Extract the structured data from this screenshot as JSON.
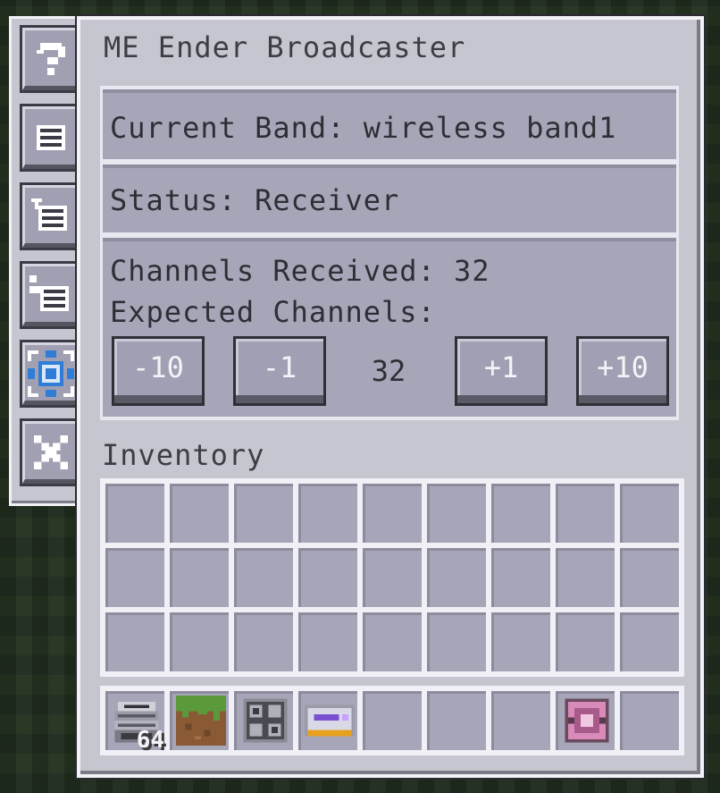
{
  "window": {
    "title": "ME Ender Broadcaster"
  },
  "sidebar": {
    "tabs": [
      {
        "name": "help-icon"
      },
      {
        "name": "list-icon"
      },
      {
        "name": "list-add-icon"
      },
      {
        "name": "list-tree-icon"
      },
      {
        "name": "priority-icon"
      },
      {
        "name": "close-icon"
      }
    ]
  },
  "info": {
    "band": "Current Band: wireless band1",
    "status": "Status: Receiver",
    "channels_received": "Channels Received: 32",
    "expected_label": "Expected Channels:"
  },
  "channels": {
    "minus10": "-10",
    "minus1": "-1",
    "value": "32",
    "plus1": "+1",
    "plus10": "+10"
  },
  "inventory": {
    "label": "Inventory",
    "hotbar": [
      {
        "item": "me-drive-icon",
        "count": "64"
      },
      {
        "item": "grass-block-icon",
        "count": ""
      },
      {
        "item": "me-chest-icon",
        "count": ""
      },
      {
        "item": "me-terminal-icon",
        "count": ""
      },
      {
        "item": "",
        "count": ""
      },
      {
        "item": "",
        "count": ""
      },
      {
        "item": "",
        "count": ""
      },
      {
        "item": "quantum-link-icon",
        "count": ""
      },
      {
        "item": "",
        "count": ""
      }
    ]
  },
  "colors": {
    "panel": "#c6c6d0",
    "slot": "#a6a6b8",
    "accent": "#2f7dd6"
  }
}
